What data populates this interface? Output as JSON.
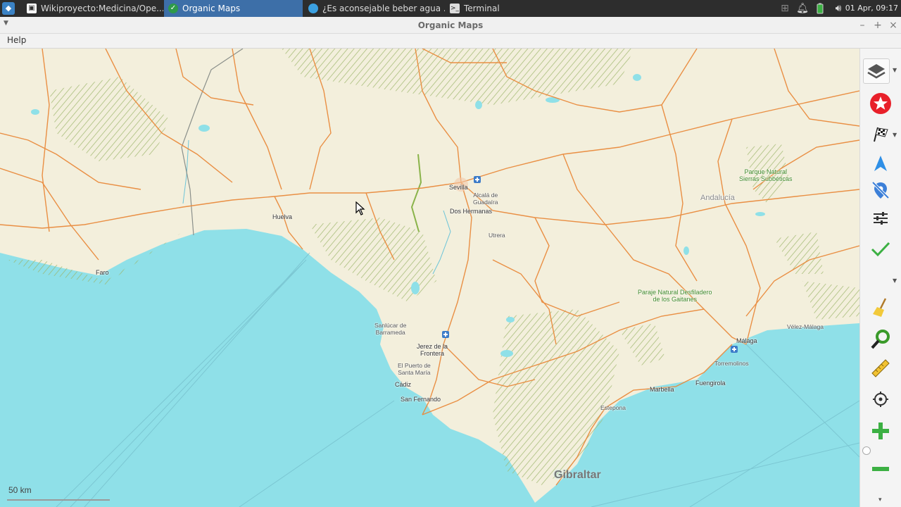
{
  "taskbar": {
    "tasks": [
      {
        "label": "Wikiproyecto:Medicina/Ope...",
        "icon": "browser-page-icon"
      },
      {
        "label": "Organic Maps",
        "icon": "organic-maps-icon"
      },
      {
        "label": "¿Es aconsejable beber agua ...",
        "icon": "globe-icon"
      },
      {
        "label": "Terminal",
        "icon": "terminal-icon"
      }
    ],
    "clock": "01 Apr, 09:17"
  },
  "window": {
    "title": "Organic Maps",
    "menu": [
      "Help"
    ]
  },
  "map": {
    "labels": {
      "sevilla": "Sevilla",
      "alcala": "Alcalá de\nGuadaíra",
      "dos_hermanas": "Dos Hermanas",
      "utrera": "Utrera",
      "huelva": "Huelva",
      "faro": "Faro",
      "sanlucar": "Sanlúcar de\nBarrameda",
      "jerez": "Jerez de la\nFrontera",
      "puerto": "El Puerto de\nSanta María",
      "cadiz": "Cádiz",
      "san_fernando": "San Fernando",
      "andalucia": "Andalucía",
      "subbeticas": "Parque Natural\nSierras Subbéticas",
      "gaitanes": "Paraje Natural Desfiladero\nde los Gaitanes",
      "velez": "Vélez-Málaga",
      "malaga": "Málaga",
      "torremolinos": "Torremolinos",
      "fuengirola": "Fuengirola",
      "marbella": "Marbella",
      "estepona": "Estepona",
      "gibraltar": "Gibraltar"
    },
    "scale": "50 km"
  },
  "colors": {
    "sea": "#8fe0e8",
    "land": "#f3efdc",
    "roads": "#e98a3c",
    "parks": "#9bb56a",
    "active_task": "#3d6fa8"
  }
}
